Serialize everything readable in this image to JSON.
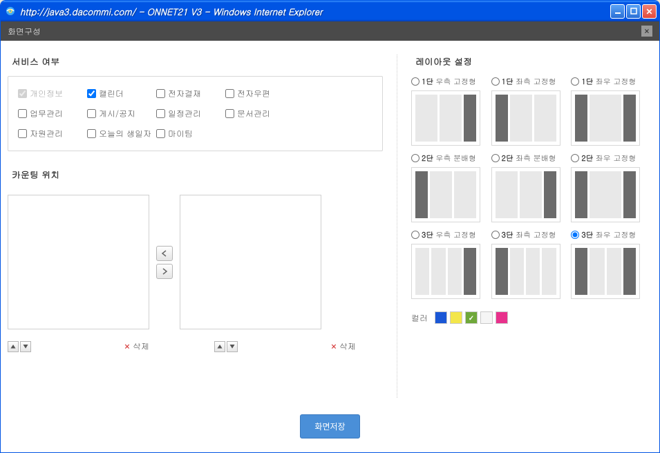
{
  "window": {
    "title": "http://java3.dacommi.com/ - ONNET21 V3 - Windows Internet Explorer"
  },
  "app": {
    "header_title": "화면구성"
  },
  "sections": {
    "service_title": "서비스 여부",
    "counting_title": "카운팅 위치",
    "layout_title": "레이아웃 설정",
    "color_label": "컬러"
  },
  "services": [
    {
      "label": "개인정보",
      "checked": true,
      "disabled": true
    },
    {
      "label": "캘린더",
      "checked": true,
      "disabled": false
    },
    {
      "label": "전자결재",
      "checked": false,
      "disabled": false
    },
    {
      "label": "전자우편",
      "checked": false,
      "disabled": false
    },
    {
      "label": "업무관리",
      "checked": false,
      "disabled": false
    },
    {
      "label": "게시/공지",
      "checked": false,
      "disabled": false
    },
    {
      "label": "일정관리",
      "checked": false,
      "disabled": false
    },
    {
      "label": "문서관리",
      "checked": false,
      "disabled": false
    },
    {
      "label": "자원관리",
      "checked": false,
      "disabled": false
    },
    {
      "label": "오늘의 생일자",
      "checked": false,
      "disabled": false
    },
    {
      "label": "마이팀",
      "checked": false,
      "disabled": false
    }
  ],
  "counting": {
    "delete_label": "삭제"
  },
  "layouts": [
    {
      "bold": "1단",
      "rest": "우측 고정형",
      "columns": [
        "light",
        "light",
        "dark"
      ],
      "selected": false
    },
    {
      "bold": "1단",
      "rest": "좌측 고정형",
      "columns": [
        "dark",
        "light",
        "light"
      ],
      "selected": false
    },
    {
      "bold": "1단",
      "rest": "좌우 고정형",
      "columns": [
        "dark",
        "light",
        "dark"
      ],
      "selected": false
    },
    {
      "bold": "2단",
      "rest": "우측 분배형",
      "columns": [
        "dark",
        "light",
        "light"
      ],
      "selected": false
    },
    {
      "bold": "2단",
      "rest": "좌측 분배형",
      "columns": [
        "light",
        "light",
        "dark"
      ],
      "selected": false
    },
    {
      "bold": "2단",
      "rest": "좌우 고정형",
      "columns": [
        "dark",
        "light",
        "dark"
      ],
      "selected": false
    },
    {
      "bold": "3단",
      "rest": "우측 고정형",
      "columns": [
        "light",
        "light",
        "light",
        "dark"
      ],
      "selected": false
    },
    {
      "bold": "3단",
      "rest": "좌측 고정형",
      "columns": [
        "dark",
        "light",
        "light",
        "light"
      ],
      "selected": false
    },
    {
      "bold": "3단",
      "rest": "좌우 고정형",
      "columns": [
        "dark",
        "light",
        "light",
        "dark"
      ],
      "selected": true
    }
  ],
  "colors": [
    {
      "hex": "#1a57d6",
      "selected": false
    },
    {
      "hex": "#f3e64a",
      "selected": false
    },
    {
      "hex": "#6fa83a",
      "selected": true
    },
    {
      "hex": "#f5f5f5",
      "selected": false
    },
    {
      "hex": "#e8318c",
      "selected": false
    }
  ],
  "footer": {
    "save_label": "화면저장"
  }
}
